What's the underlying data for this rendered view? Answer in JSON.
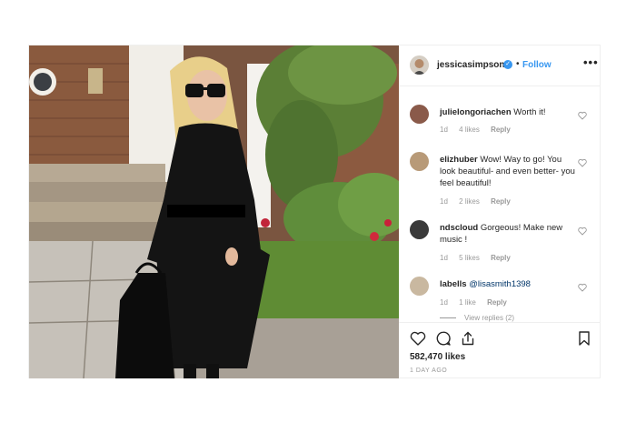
{
  "post": {
    "photo_alt": "",
    "header": {
      "username": "jessicasimpson",
      "verified_glyph": "✓",
      "separator": "•",
      "follow_label": "Follow",
      "more_label": "•••"
    },
    "comments": [
      {
        "username": "julielongoriachen",
        "text": "Worth it!",
        "age": "1d",
        "likes": "4 likes",
        "reply_label": "Reply",
        "avatar_color": "#8a5a4a"
      },
      {
        "username": "elizhuber",
        "text": "Wow! Way to go! You look beautiful- and even better- you feel beautiful!",
        "age": "1d",
        "likes": "2 likes",
        "reply_label": "Reply",
        "avatar_color": "#b89a78"
      },
      {
        "username": "ndscloud",
        "text": "Gorgeous! Make new music !",
        "age": "1d",
        "likes": "5 likes",
        "reply_label": "Reply",
        "avatar_color": "#3a3a3a"
      },
      {
        "username": "labells",
        "mention": "@lisasmith1398",
        "age": "1d",
        "likes": "1 like",
        "reply_label": "Reply",
        "avatar_color": "#c9b8a0"
      }
    ],
    "view_replies": "View replies (2)",
    "likes_count": "582,470 likes",
    "time_ago": "1 DAY AGO"
  }
}
